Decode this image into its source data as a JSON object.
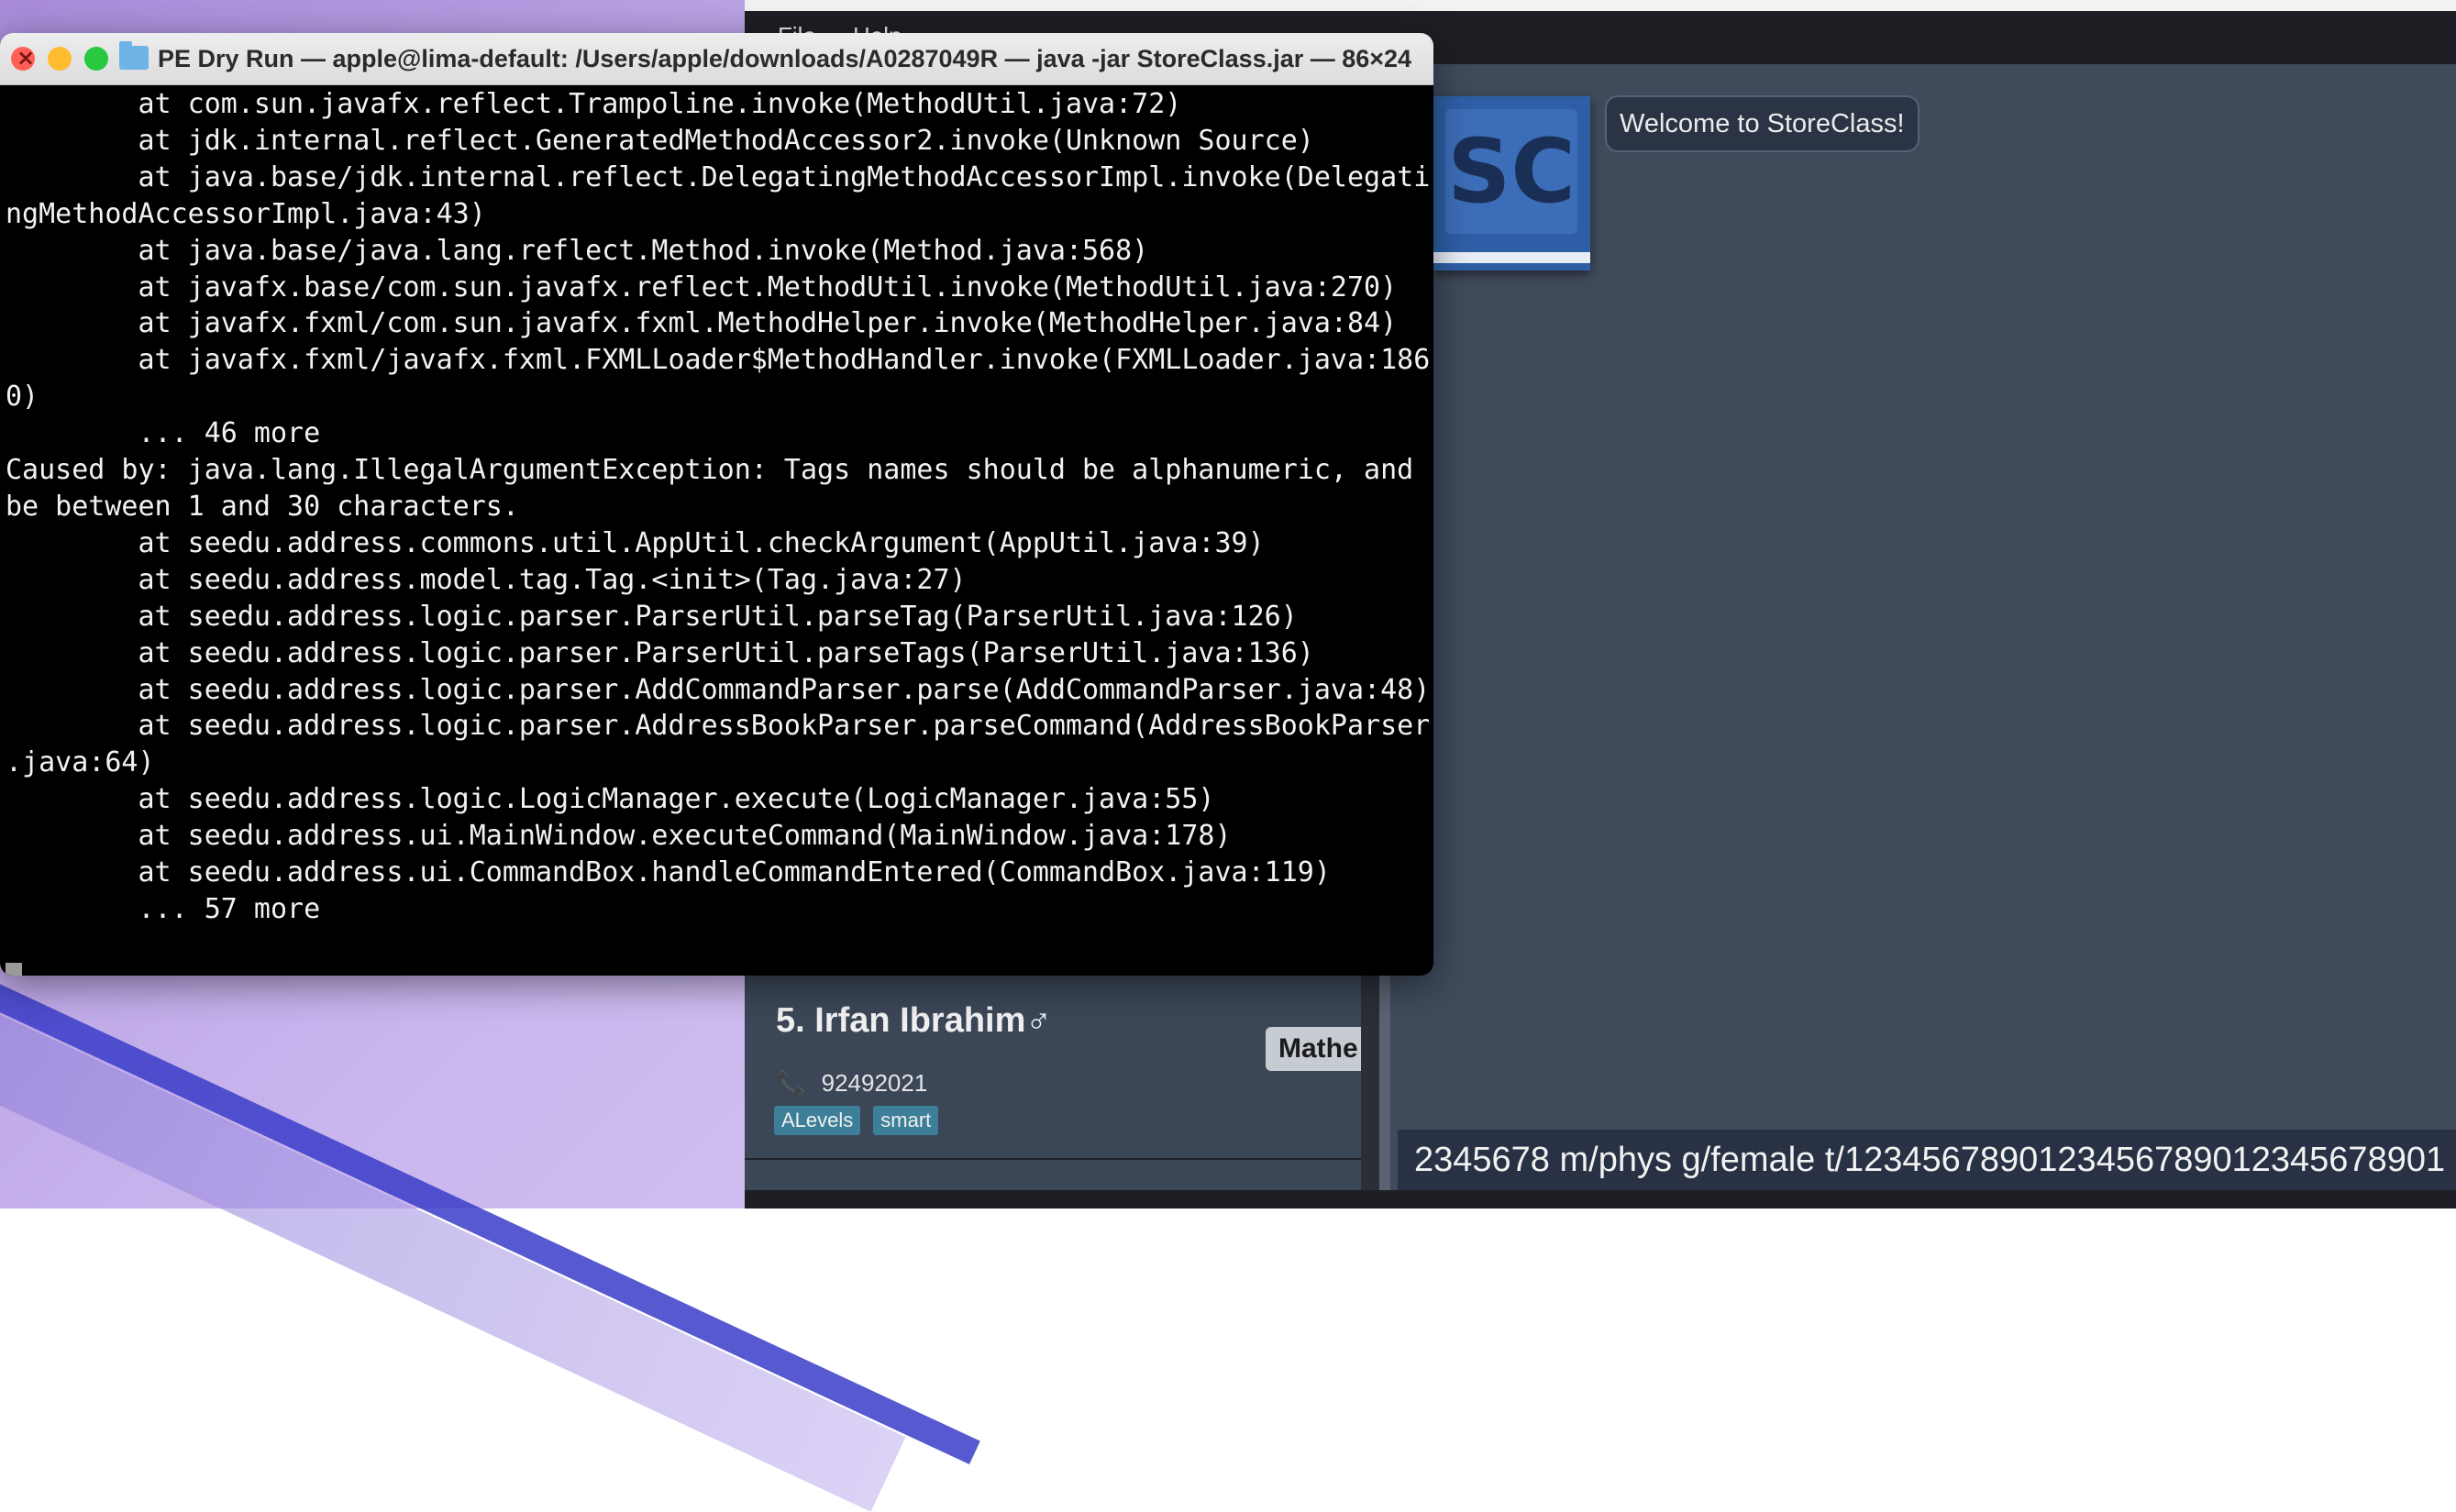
{
  "terminal": {
    "title": "PE Dry Run — apple@lima-default: /Users/apple/downloads/A0287049R — java -jar StoreClass.jar — 86×24",
    "lines": [
      "        at com.sun.javafx.reflect.Trampoline.invoke(MethodUtil.java:72)",
      "        at jdk.internal.reflect.GeneratedMethodAccessor2.invoke(Unknown Source)",
      "        at java.base/jdk.internal.reflect.DelegatingMethodAccessorImpl.invoke(Delegati",
      "ngMethodAccessorImpl.java:43)",
      "        at java.base/java.lang.reflect.Method.invoke(Method.java:568)",
      "        at javafx.base/com.sun.javafx.reflect.MethodUtil.invoke(MethodUtil.java:270)",
      "        at javafx.fxml/com.sun.javafx.fxml.MethodHelper.invoke(MethodHelper.java:84)",
      "        at javafx.fxml/javafx.fxml.FXMLLoader$MethodHandler.invoke(FXMLLoader.java:186",
      "0)",
      "        ... 46 more",
      "Caused by: java.lang.IllegalArgumentException: Tags names should be alphanumeric, and",
      "be between 1 and 30 characters.",
      "        at seedu.address.commons.util.AppUtil.checkArgument(AppUtil.java:39)",
      "        at seedu.address.model.tag.Tag.<init>(Tag.java:27)",
      "        at seedu.address.logic.parser.ParserUtil.parseTag(ParserUtil.java:126)",
      "        at seedu.address.logic.parser.ParserUtil.parseTags(ParserUtil.java:136)",
      "        at seedu.address.logic.parser.AddCommandParser.parse(AddCommandParser.java:48)",
      "        at seedu.address.logic.parser.AddressBookParser.parseCommand(AddressBookParser",
      ".java:64)",
      "        at seedu.address.logic.LogicManager.execute(LogicManager.java:55)",
      "        at seedu.address.ui.MainWindow.executeCommand(MainWindow.java:178)",
      "        at seedu.address.ui.CommandBox.handleCommandEntered(CommandBox.java:119)",
      "        ... 57 more"
    ]
  },
  "app": {
    "menu": {
      "file": "File",
      "help": "Help"
    },
    "logo_text": "SC",
    "welcome": "Welcome to StoreClass!",
    "person": {
      "name": "5. Irfan Ibrahim♂",
      "phone_icon": "📞",
      "phone": "92492021",
      "tags": [
        "ALevels",
        "smart"
      ],
      "subject": "Mathe"
    },
    "command_text": "2345678 m/phys g/female t/1234567890123456789012345678901"
  },
  "colors": {
    "app_bg": "#3f4a5b",
    "menubar": "#1d1f24",
    "tag": "#3d7f99",
    "terminal_bg": "#000000",
    "close": "#ff5f57",
    "minimize": "#febc2e",
    "maximize": "#28c840"
  }
}
